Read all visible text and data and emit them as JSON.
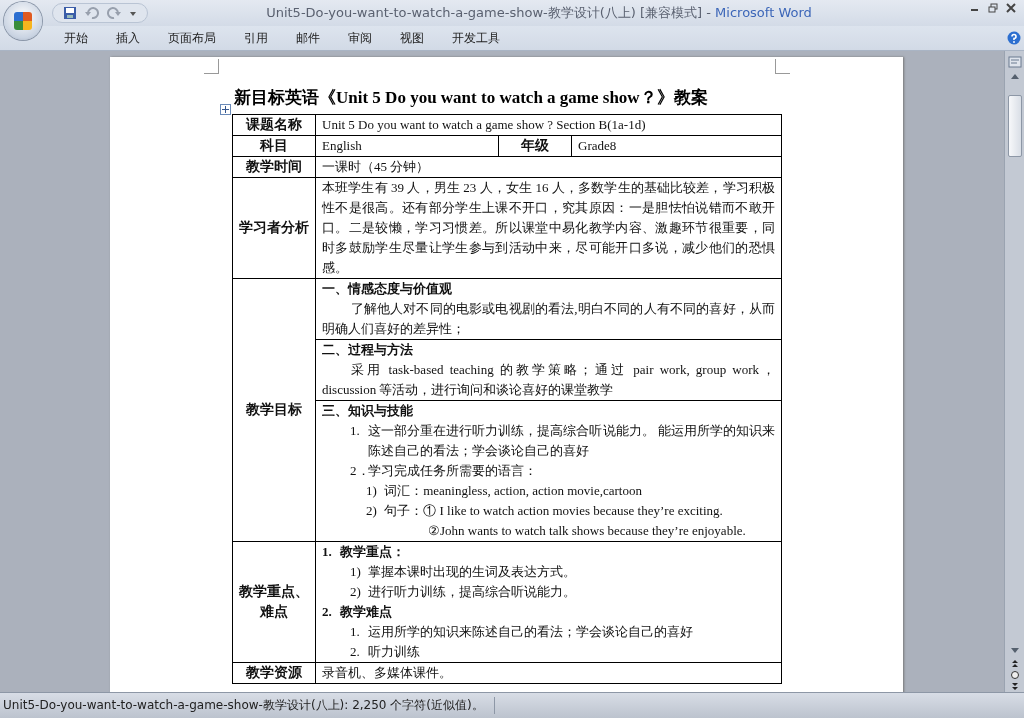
{
  "window": {
    "title": "Unit5-Do-you-want-to-watch-a-game-show-教学设计(八上) [兼容模式] -",
    "app": "Microsoft Word"
  },
  "ribbon": {
    "tabs": [
      {
        "label": "开始"
      },
      {
        "label": "插入"
      },
      {
        "label": "页面布局"
      },
      {
        "label": "引用"
      },
      {
        "label": "邮件"
      },
      {
        "label": "审阅"
      },
      {
        "label": "视图"
      },
      {
        "label": "开发工具"
      }
    ]
  },
  "document": {
    "title": "新目标英语《Unit 5 Do you want to watch a game show？》教案",
    "rows": [
      {
        "kind": "single",
        "label": "课题名称",
        "value": "Unit 5 Do you want to watch a game show ? Section B(1a-1d)"
      },
      {
        "kind": "pair",
        "label": "科目",
        "value": "English",
        "label2": "年级",
        "value2": "Grade8"
      },
      {
        "kind": "single",
        "label": "教学时间",
        "value": "一课时（45 分钟）"
      },
      {
        "kind": "single",
        "label": "学习者分析",
        "value": "本班学生有 39 人，男生 23 人，女生 16 人，多数学生的基础比较差，学习积极性不是很高。还有部分学生上课不开口，究其原因：一是胆怯怕说错而不敢开口。二是较懒，学习习惯差。所以课堂中易化教学内容、激趣环节很重要，同时多鼓励学生尽量让学生参与到活动中来，尽可能开口多说，减少他们的恐惧感。"
      },
      {
        "kind": "sections",
        "label": "教学目标",
        "sections": [
          {
            "lines": [
              {
                "kind": "heading",
                "text": "一、情感态度与价值观"
              },
              {
                "kind": "indent",
                "text": "了解他人对不同的电影或电视剧的看法,明白不同的人有不同的喜好，从而明确人们喜好的差异性；"
              }
            ]
          },
          {
            "lines": [
              {
                "kind": "heading",
                "text": "二、过程与方法"
              },
              {
                "kind": "indent",
                "text": "采用 task-based teaching 的教学策略；通过 pair work, group work，discussion 等活动，进行询问和谈论喜好的课堂教学"
              }
            ]
          },
          {
            "lines": [
              {
                "kind": "heading",
                "text": "三、知识与技能"
              },
              {
                "kind": "item",
                "marker": "1.",
                "text": "这一部分重在进行听力训练，提高综合听说能力。 能运用所学的知识来陈述自己的看法；学会谈论自己的喜好"
              },
              {
                "kind": "item",
                "marker": "2．",
                "text": "学习完成任务所需要的语言："
              },
              {
                "kind": "subitem",
                "marker": "1)",
                "text": "词汇：meaningless, action, action movie,cartoon"
              },
              {
                "kind": "subitem",
                "marker": "2)",
                "text": "句子：① I like to watch action movies because they’re exciting."
              },
              {
                "kind": "continuation",
                "text": "②John wants to watch talk shows because they’re enjoyable."
              }
            ]
          }
        ]
      },
      {
        "kind": "sections",
        "label": "教学重点、难点",
        "sections": [
          {
            "lines": [
              {
                "kind": "boldhead",
                "marker": "1.",
                "text": "教学重点："
              },
              {
                "kind": "item",
                "marker": "1)",
                "text": "掌握本课时出现的生词及表达方式。"
              },
              {
                "kind": "item",
                "marker": "2)",
                "text": "进行听力训练，提高综合听说能力。"
              },
              {
                "kind": "boldhead",
                "marker": "2.",
                "text": "教学难点"
              },
              {
                "kind": "item",
                "marker": "1.",
                "text": "运用所学的知识来陈述自己的看法；学会谈论自己的喜好"
              },
              {
                "kind": "item",
                "marker": "2.",
                "text": "听力训练"
              }
            ]
          }
        ]
      },
      {
        "kind": "single",
        "label": "教学资源",
        "value": "录音机、多媒体课件。"
      }
    ]
  },
  "status_bar": {
    "text": "Unit5-Do-you-want-to-watch-a-game-show-教学设计(八上): 2,250 个字符(近似值)。"
  }
}
